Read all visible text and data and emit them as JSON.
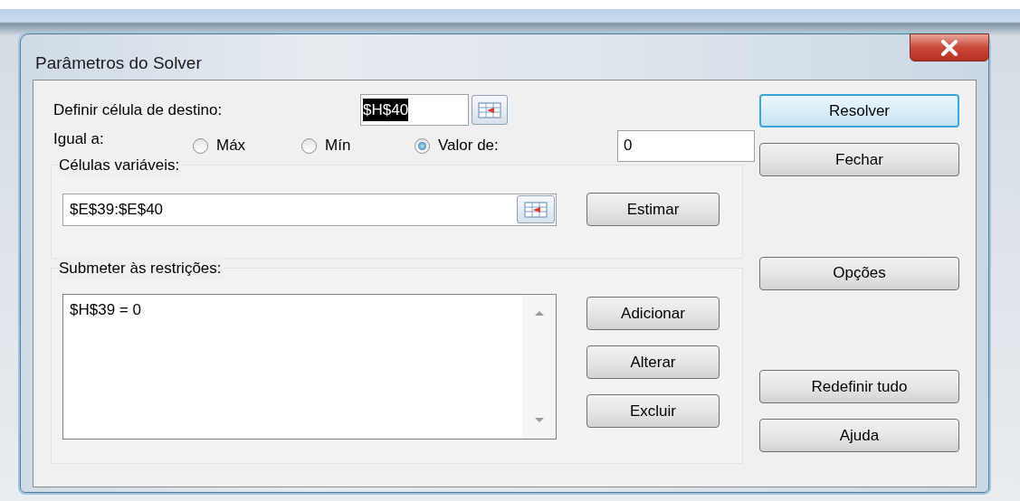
{
  "window": {
    "title": "Parâmetros do Solver"
  },
  "target_cell": {
    "label": "Definir célula de destino:",
    "value": "$H$40",
    "selected": true
  },
  "equal_to": {
    "label": "Igual a:",
    "options": [
      {
        "label": "Máx",
        "selected": false
      },
      {
        "label": "Mín",
        "selected": false
      },
      {
        "label": "Valor de:",
        "selected": true
      }
    ],
    "value": "0"
  },
  "variable_cells": {
    "label": "Células variáveis:",
    "value": "$E$39:$E$40",
    "button": "Estimar"
  },
  "constraints": {
    "label": "Submeter às restrições:",
    "items": [
      "$H$39 = 0"
    ],
    "buttons": [
      "Adicionar",
      "Alterar",
      "Excluir"
    ]
  },
  "side_buttons": [
    [
      {
        "label": "Resolver",
        "default": true
      },
      {
        "label": "Fechar",
        "default": false
      }
    ],
    [
      {
        "label": "Opções",
        "default": false
      }
    ],
    [
      {
        "label": "Redefinir tudo",
        "default": false
      },
      {
        "label": "Ajuda",
        "default": false
      }
    ]
  ]
}
